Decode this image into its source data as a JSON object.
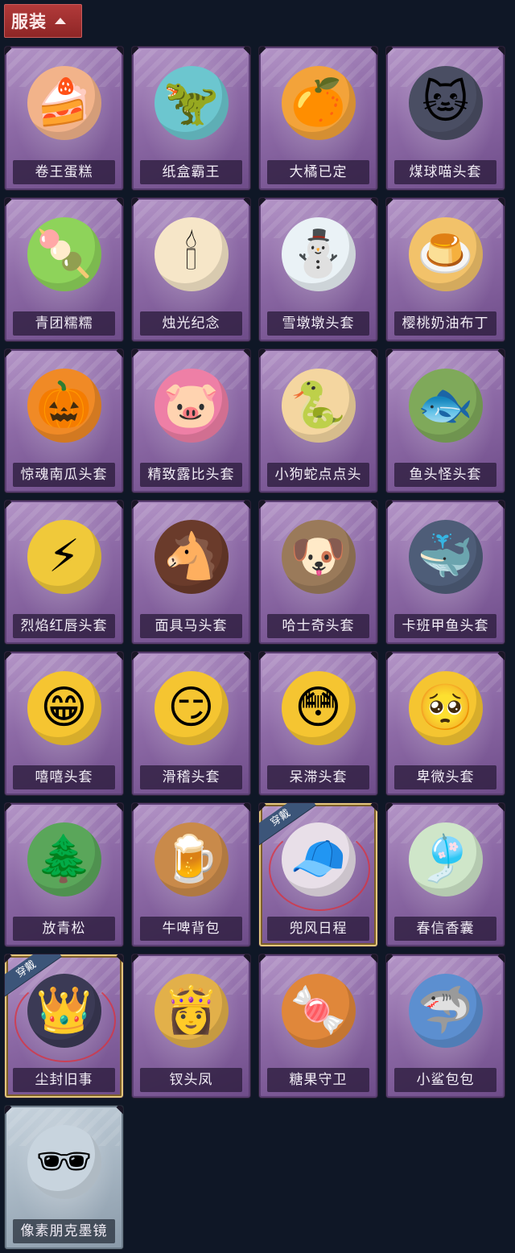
{
  "header": {
    "title": "服装"
  },
  "items": [
    {
      "label": "卷王蛋糕",
      "icon": "cake-roll-icon",
      "glyph": "🍰",
      "color": "#f2b38a"
    },
    {
      "label": "纸盒霸王",
      "icon": "box-dinosaur-icon",
      "glyph": "🦖",
      "color": "#6cc6cf"
    },
    {
      "label": "大橘已定",
      "icon": "orange-slice-icon",
      "glyph": "🍊",
      "color": "#f3a33a"
    },
    {
      "label": "煤球喵头套",
      "icon": "black-cat-icon",
      "glyph": "🐱",
      "color": "#4a4e63"
    },
    {
      "label": "青团糯糯",
      "icon": "green-rice-ball-icon",
      "glyph": "🍡",
      "color": "#8ed35a"
    },
    {
      "label": "烛光纪念",
      "icon": "candle-icon",
      "glyph": "🕯",
      "color": "#f6e6c8"
    },
    {
      "label": "雪墩墩头套",
      "icon": "snowman-icon",
      "glyph": "⛄",
      "color": "#eaf2f6"
    },
    {
      "label": "樱桃奶油布丁",
      "icon": "pudding-icon",
      "glyph": "🍮",
      "color": "#f2c26a"
    },
    {
      "label": "惊魂南瓜头套",
      "icon": "pumpkin-icon",
      "glyph": "🎃",
      "color": "#f08a26"
    },
    {
      "label": "精致露比头套",
      "icon": "pink-beaver-icon",
      "glyph": "🐷",
      "color": "#ee7fa6"
    },
    {
      "label": "小狗蛇点点头",
      "icon": "snake-dog-icon",
      "glyph": "🐍",
      "color": "#f4d6a0"
    },
    {
      "label": "鱼头怪头套",
      "icon": "fish-mask-icon",
      "glyph": "🐟",
      "color": "#7fa95a"
    },
    {
      "label": "烈焰红唇头套",
      "icon": "pikachu-mask-icon",
      "glyph": "⚡",
      "color": "#f0c93a"
    },
    {
      "label": "面具马头套",
      "icon": "horse-mask-icon",
      "glyph": "🐴",
      "color": "#6a3b2b"
    },
    {
      "label": "哈士奇头套",
      "icon": "husky-mask-icon",
      "glyph": "🐶",
      "color": "#9a7a5a"
    },
    {
      "label": "卡班甲鱼头套",
      "icon": "whale-mask-icon",
      "glyph": "🐳",
      "color": "#4e5d78"
    },
    {
      "label": "嘻嘻头套",
      "icon": "grin-emoji-icon",
      "glyph": "😁",
      "color": "#f5c531"
    },
    {
      "label": "滑稽头套",
      "icon": "silly-emoji-icon",
      "glyph": "😏",
      "color": "#f5c531"
    },
    {
      "label": "呆滞头套",
      "icon": "stare-emoji-icon",
      "glyph": "😳",
      "color": "#f5c531"
    },
    {
      "label": "卑微头套",
      "icon": "shy-emoji-icon",
      "glyph": "🥺",
      "color": "#f5c531"
    },
    {
      "label": "放青松",
      "icon": "bonsai-pine-icon",
      "glyph": "🌲",
      "color": "#5aa65a"
    },
    {
      "label": "牛啤背包",
      "icon": "cow-beer-mug-icon",
      "glyph": "🍺",
      "color": "#c98a4a"
    },
    {
      "label": "兜风日程",
      "icon": "cap-character-icon",
      "glyph": "🧢",
      "color": "#e8dfe8",
      "equipped": true,
      "badge": "穿戴"
    },
    {
      "label": "春信香囊",
      "icon": "sachet-icon",
      "glyph": "🎐",
      "color": "#cfe6c9"
    },
    {
      "label": "尘封旧事",
      "icon": "crowned-character-icon",
      "glyph": "👑",
      "color": "#3b3a55",
      "equipped": true,
      "badge": "穿戴"
    },
    {
      "label": "钗头凤",
      "icon": "phoenix-crown-icon",
      "glyph": "👸",
      "color": "#e2b04a"
    },
    {
      "label": "糖果守卫",
      "icon": "candy-guard-icon",
      "glyph": "🍬",
      "color": "#e0873a"
    },
    {
      "label": "小鲨包包",
      "icon": "shark-bag-icon",
      "glyph": "🦈",
      "color": "#5c8fd0"
    },
    {
      "label": "像素朋克墨镜",
      "icon": "pixel-sunglasses-icon",
      "glyph": "🕶",
      "color": "#c8d4de",
      "gray": true
    }
  ]
}
